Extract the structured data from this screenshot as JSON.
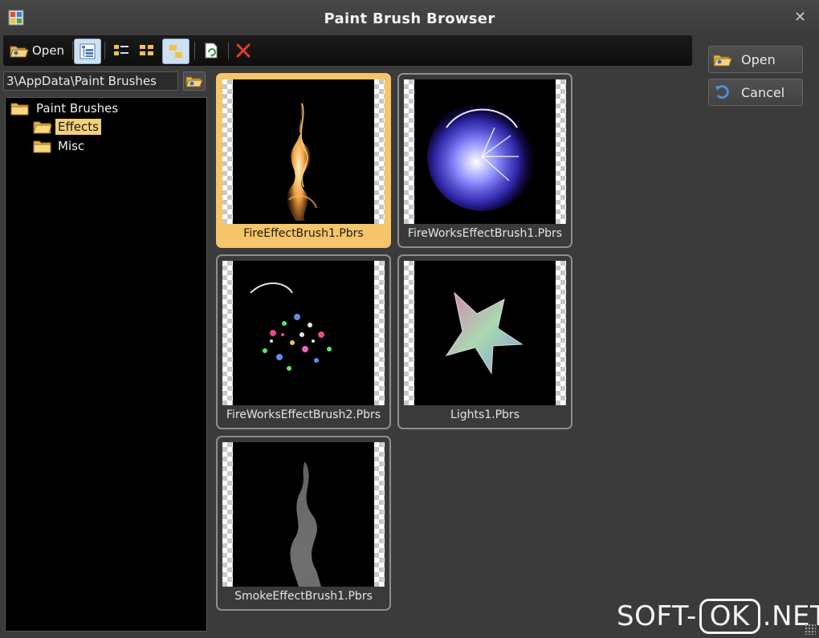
{
  "window": {
    "title": "Paint Brush Browser"
  },
  "toolbar": {
    "open_label": "Open"
  },
  "path": {
    "value": "3\\AppData\\Paint Brushes"
  },
  "tree": {
    "root": "Paint Brushes",
    "children": [
      "Effects",
      "Misc"
    ],
    "selected": "Effects"
  },
  "brushes": [
    {
      "name": "FireEffectBrush1.Pbrs",
      "selected": true
    },
    {
      "name": "FireWorksEffectBrush1.Pbrs",
      "selected": false
    },
    {
      "name": "FireWorksEffectBrush2.Pbrs",
      "selected": false
    },
    {
      "name": "Lights1.Pbrs",
      "selected": false
    },
    {
      "name": "SmokeEffectBrush1.Pbrs",
      "selected": false
    }
  ],
  "buttons": {
    "open": "Open",
    "cancel": "Cancel"
  },
  "watermark": {
    "left": "SOFT-",
    "box": "OK",
    "right": ".NET"
  },
  "colors": {
    "selection": "#f5c56a",
    "tree_selection": "#f3cf7a",
    "delete": "#e23b2a"
  }
}
